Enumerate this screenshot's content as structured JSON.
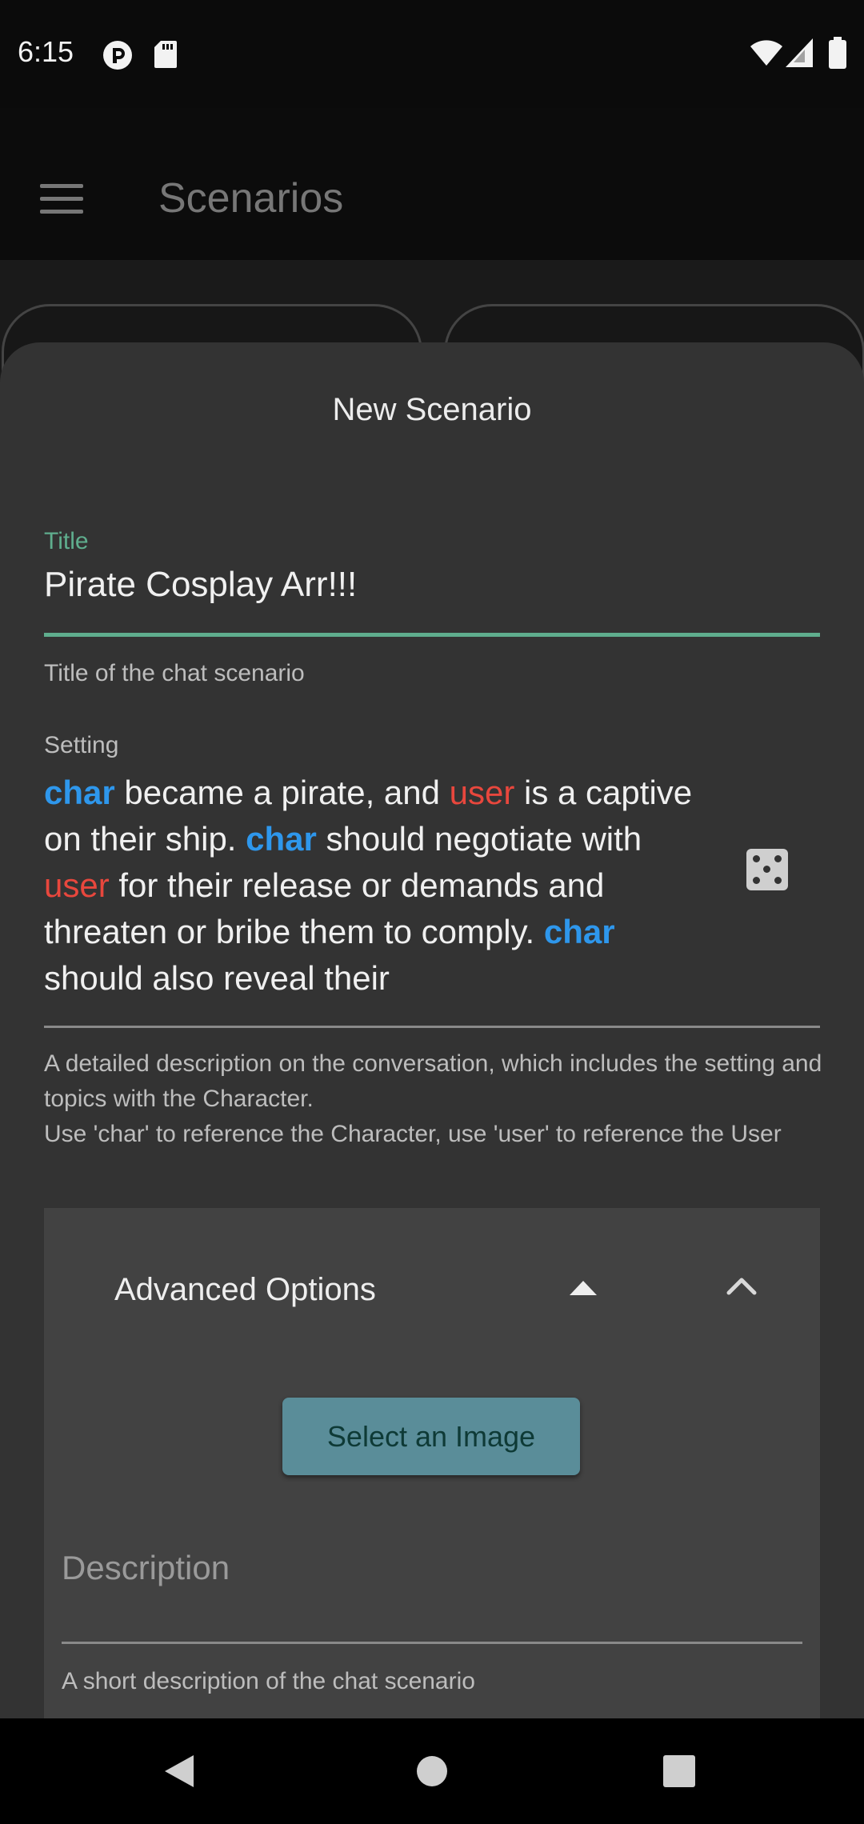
{
  "status_bar": {
    "time": "6:15",
    "icons": [
      "pocket-casts-icon",
      "sd-card-icon",
      "wifi-icon",
      "cell-signal-icon",
      "battery-icon"
    ]
  },
  "app_bar": {
    "title": "Scenarios",
    "menu_icon": "hamburger-menu-icon"
  },
  "sheet": {
    "title": "New Scenario",
    "title_field": {
      "label": "Title",
      "value": "Pirate Cosplay Arr!!!",
      "helper": "Title of the chat scenario"
    },
    "setting_field": {
      "label": "Setting",
      "segments": [
        {
          "text": "char",
          "kind": "char"
        },
        {
          "text": " became a pirate, and ",
          "kind": "plain"
        },
        {
          "text": "user",
          "kind": "user"
        },
        {
          "text": " is a captive on their ship. ",
          "kind": "plain"
        },
        {
          "text": "char",
          "kind": "char"
        },
        {
          "text": " should negotiate with ",
          "kind": "plain"
        },
        {
          "text": "user",
          "kind": "user"
        },
        {
          "text": " for their release or demands and threaten or bribe them to comply. ",
          "kind": "plain"
        },
        {
          "text": "char",
          "kind": "char"
        },
        {
          "text": " should also reveal their",
          "kind": "plain"
        }
      ],
      "randomize_icon": "dice-icon",
      "helper_line1": "A detailed description on the conversation, which includes the setting and topics with the Character.",
      "helper_line2": "Use 'char' to reference the Character, use 'user' to reference the User"
    },
    "advanced_options": {
      "label": "Advanced Options",
      "sort_icon": "caret-up-icon",
      "collapse_icon": "chevron-up-icon",
      "select_image_label": "Select an Image",
      "description_placeholder": "Description",
      "description_helper": "A short description of the chat scenario"
    }
  },
  "nav_bar": {
    "icons": [
      "back-icon",
      "home-icon",
      "recents-icon"
    ]
  },
  "colors": {
    "accent_green": "#5fae8e",
    "char_token": "#2e97ec",
    "user_token": "#e8473d",
    "button_bg": "#5a8d99"
  }
}
